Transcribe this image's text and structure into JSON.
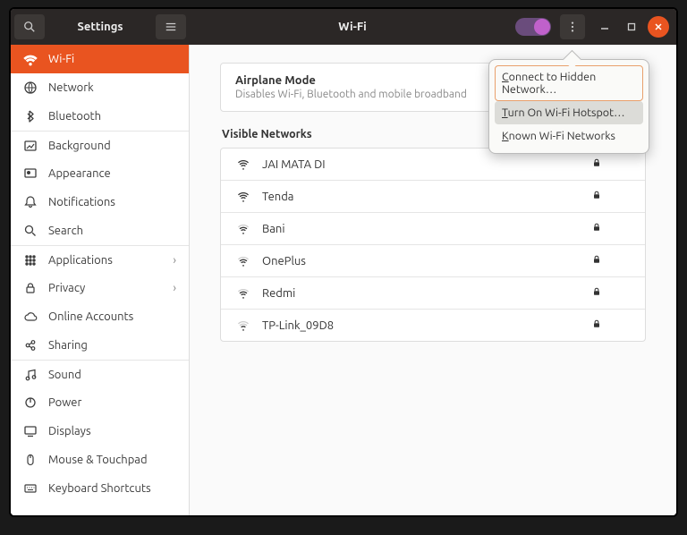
{
  "titlebar": {
    "left_title": "Settings",
    "right_title": "Wi-Fi"
  },
  "sidebar": {
    "items": [
      {
        "icon": "wifi",
        "label": "Wi-Fi",
        "active": true
      },
      {
        "icon": "globe",
        "label": "Network"
      },
      {
        "icon": "bluetooth",
        "label": "Bluetooth"
      },
      {
        "icon": "background",
        "label": "Background",
        "sep": true
      },
      {
        "icon": "appearance",
        "label": "Appearance"
      },
      {
        "icon": "bell",
        "label": "Notifications"
      },
      {
        "icon": "search",
        "label": "Search"
      },
      {
        "icon": "grid",
        "label": "Applications",
        "sep": true,
        "chevron": true
      },
      {
        "icon": "lock",
        "label": "Privacy",
        "chevron": true
      },
      {
        "icon": "cloud",
        "label": "Online Accounts"
      },
      {
        "icon": "share",
        "label": "Sharing"
      },
      {
        "icon": "music",
        "label": "Sound",
        "sep": true
      },
      {
        "icon": "power",
        "label": "Power"
      },
      {
        "icon": "display",
        "label": "Displays"
      },
      {
        "icon": "mouse",
        "label": "Mouse & Touchpad"
      },
      {
        "icon": "keyboard",
        "label": "Keyboard Shortcuts"
      }
    ]
  },
  "airplane": {
    "title": "Airplane Mode",
    "sub": "Disables Wi-Fi, Bluetooth and mobile broadband"
  },
  "visible_label": "Visible Networks",
  "networks": [
    {
      "name": "JAI MATA DI",
      "strength": 4,
      "secure": true
    },
    {
      "name": "Tenda",
      "strength": 4,
      "secure": true
    },
    {
      "name": "Bani",
      "strength": 3,
      "secure": true
    },
    {
      "name": "OnePlus",
      "strength": 3,
      "secure": true
    },
    {
      "name": "Redmi",
      "strength": 3,
      "secure": true
    },
    {
      "name": "TP-Link_09D8",
      "strength": 2,
      "secure": true
    }
  ],
  "popover": {
    "items": [
      {
        "label": "Connect to Hidden Network…",
        "ul": "C",
        "focus": true
      },
      {
        "label": "Turn On Wi-Fi Hotspot…",
        "ul": "T",
        "hover": true
      },
      {
        "label": "Known Wi-Fi Networks",
        "ul": "K"
      }
    ]
  }
}
